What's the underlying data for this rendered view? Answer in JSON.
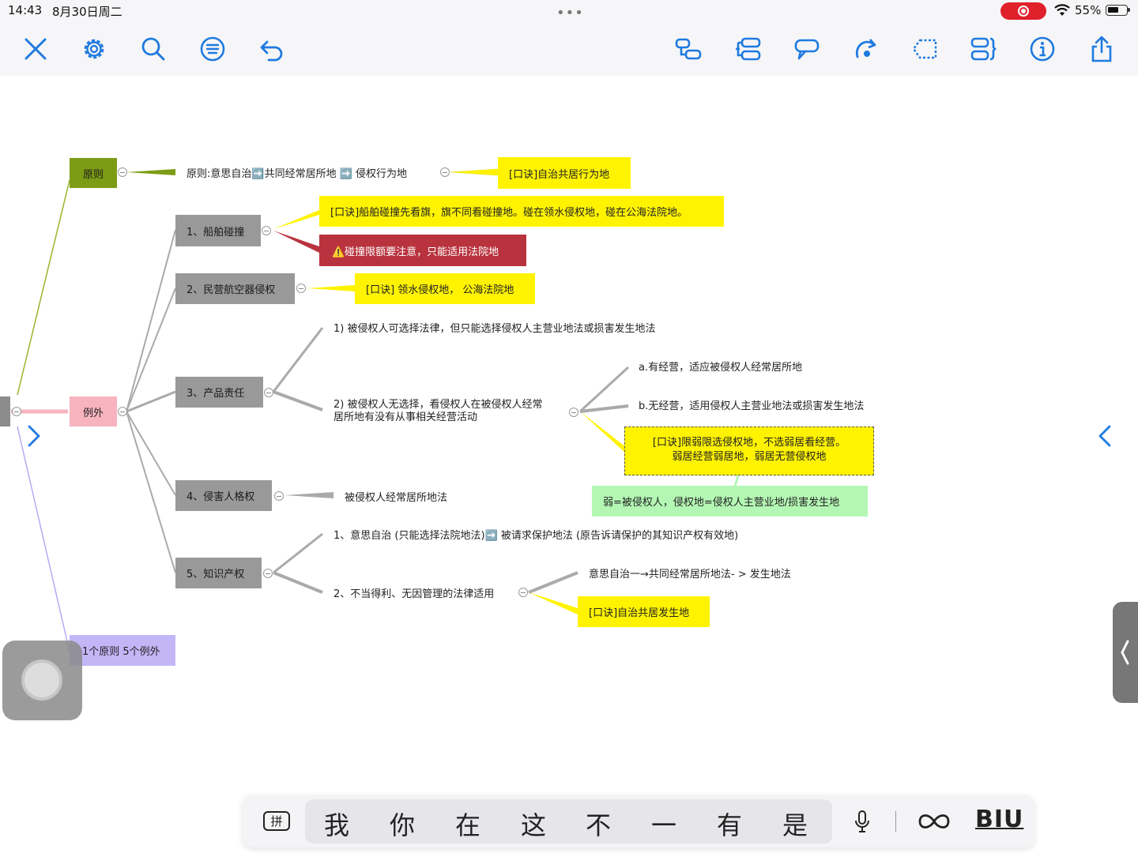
{
  "status": {
    "time": "14:43",
    "date": "8月30日周二",
    "battery": "55%"
  },
  "toolbar": {
    "left": [
      "close-icon",
      "gear-icon",
      "search-icon",
      "list-icon",
      "undo-icon"
    ],
    "right": [
      "topic-icon",
      "subtopic-icon",
      "callout-icon",
      "relationship-icon",
      "boundary-icon",
      "summary-icon",
      "info-icon",
      "share-icon"
    ]
  },
  "mindmap": {
    "n_principle": "原则",
    "n_exception": "例外",
    "n_summary": "1个原则 5个例外",
    "principle_text": "原则:意思自治➡️共同经常居所地 ➡️ 侵权行为地",
    "principle_tip": "[口诀]自治共居行为地",
    "c1": "1、船舶碰撞",
    "c1_tip": "[口诀]船舶碰撞先看旗，旗不同看碰撞地。碰在领水侵权地，碰在公海法院地。",
    "c1_warn": "⚠️碰撞限额要注意，只能适用法院地",
    "c2": "2、民营航空器侵权",
    "c2_tip": "[口诀] 领水侵权地， 公海法院地",
    "c3": "3、产品责任",
    "c3_a": "1) 被侵权人可选择法律，但只能选择侵权人主营业地法或损害发生地法",
    "c3_b_line1": "2) 被侵权人无选择，看侵权人在被侵权人经常",
    "c3_b_line2": "居所地有没有从事相关经营活动",
    "c3_b1": "a.有经营，适应被侵权人经常居所地",
    "c3_b2": "b.无经营，适用侵权人主营业地法或损害发生地法",
    "c3_tip_line1": "[口诀]限弱限选侵权地，不选弱居看经营。",
    "c3_tip_line2": "弱居经营弱居地，弱居无营侵权地",
    "c3_note": "弱=被侵权人，侵权地=侵权人主营业地/损害发生地",
    "c4": "4、侵害人格权",
    "c4_a": "被侵权人经常居所地法",
    "c5": "5、知识产权",
    "c5_a": "1、意思自治 (只能选择法院地法)➡️ 被请求保护地法 (原告诉请保护的其知识产权有效地)",
    "c5_b": "2、不当得利、无因管理的法律适用",
    "c5_b1": "意思自治一→共同经常居所地法- > 发生地法",
    "c5_b_tip": "[口诀]自治共居发生地"
  },
  "keyboard": {
    "ime": "拼",
    "candidates": [
      "我",
      "你",
      "在",
      "这",
      "不",
      "一",
      "有",
      "是"
    ],
    "format": "BIU"
  }
}
